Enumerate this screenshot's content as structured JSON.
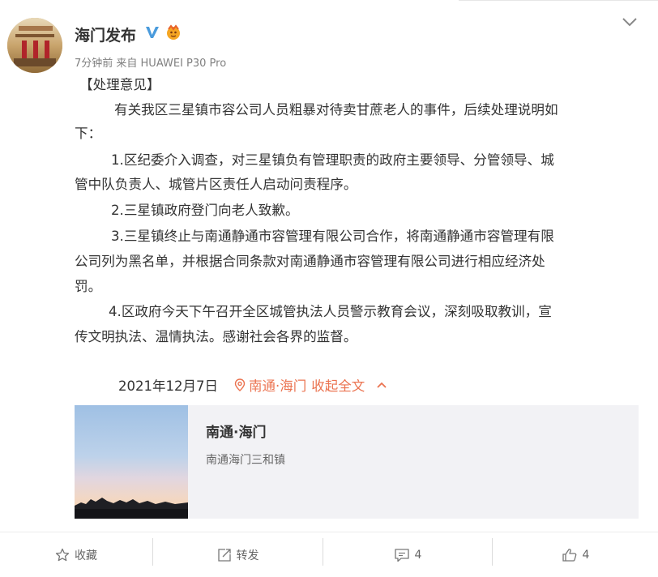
{
  "post": {
    "username": "海门发布",
    "meta": "7分钟前 来自 HUAWEI P30 Pro",
    "lines": [
      "【处理意见】",
      "有关我区三星镇市容公司人员粗暴对待卖甘蔗老人的事件，后续处理说明如",
      "下：",
      "1.区纪委介入调查，对三星镇负有管理职责的政府主要领导、分管领导、城",
      "管中队负责人、城管片区责任人启动问责程序。",
      "2.三星镇政府登门向老人致歉。",
      "3.三星镇终止与南通静通市容管理有限公司合作，将南通静通市容管理有限",
      "公司列为黑名单，并根据合同条款对南通静通市容管理有限公司进行相应经济处",
      "罚。",
      "4.区政府今天下午召开全区城管执法人员警示教育会议，深刻吸取教训，宣",
      "传文明执法、温情执法。感谢社会各界的监督。"
    ],
    "date": "2021年12月7日",
    "location": "南通·海门",
    "collapse": "收起全文"
  },
  "location_card": {
    "title": "南通·海门",
    "subtitle": "南通海门三和镇"
  },
  "actions": {
    "favorite": "收藏",
    "repost": "转发",
    "comments": "4",
    "likes": "4"
  },
  "colors": {
    "link": "#eb7350",
    "verified_blue": "#4a9bdc",
    "text": "#333333",
    "meta": "#808080"
  }
}
